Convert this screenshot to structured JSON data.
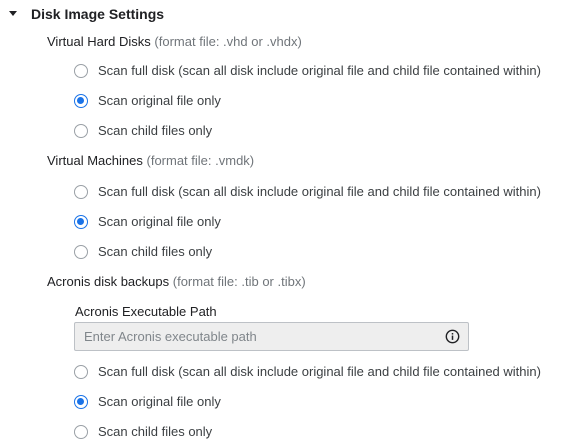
{
  "section": {
    "title": "Disk Image Settings"
  },
  "groups": [
    {
      "title": "Virtual Hard Disks",
      "format_note": "(format file: .vhd or .vhdx)",
      "options": [
        {
          "label": "Scan full disk (scan all disk include original file and child file contained within)",
          "checked": false
        },
        {
          "label": "Scan original file only",
          "checked": true
        },
        {
          "label": "Scan child files only",
          "checked": false
        }
      ]
    },
    {
      "title": "Virtual Machines",
      "format_note": "(format file: .vmdk)",
      "options": [
        {
          "label": "Scan full disk (scan all disk include original file and child file contained within)",
          "checked": false
        },
        {
          "label": "Scan original file only",
          "checked": true
        },
        {
          "label": "Scan child files only",
          "checked": false
        }
      ]
    },
    {
      "title": "Acronis disk backups",
      "format_note": "(format file: .tib or .tibx)",
      "path_field": {
        "label": "Acronis Executable Path",
        "value": "",
        "placeholder": "Enter Acronis executable path",
        "icon": "info-icon"
      },
      "options": [
        {
          "label": "Scan full disk (scan all disk include original file and child file contained within)",
          "checked": false
        },
        {
          "label": "Scan original file only",
          "checked": true
        },
        {
          "label": "Scan child files only",
          "checked": false
        }
      ]
    }
  ],
  "colors": {
    "accent": "#1a73e8",
    "input_bg": "#eeeeee"
  }
}
